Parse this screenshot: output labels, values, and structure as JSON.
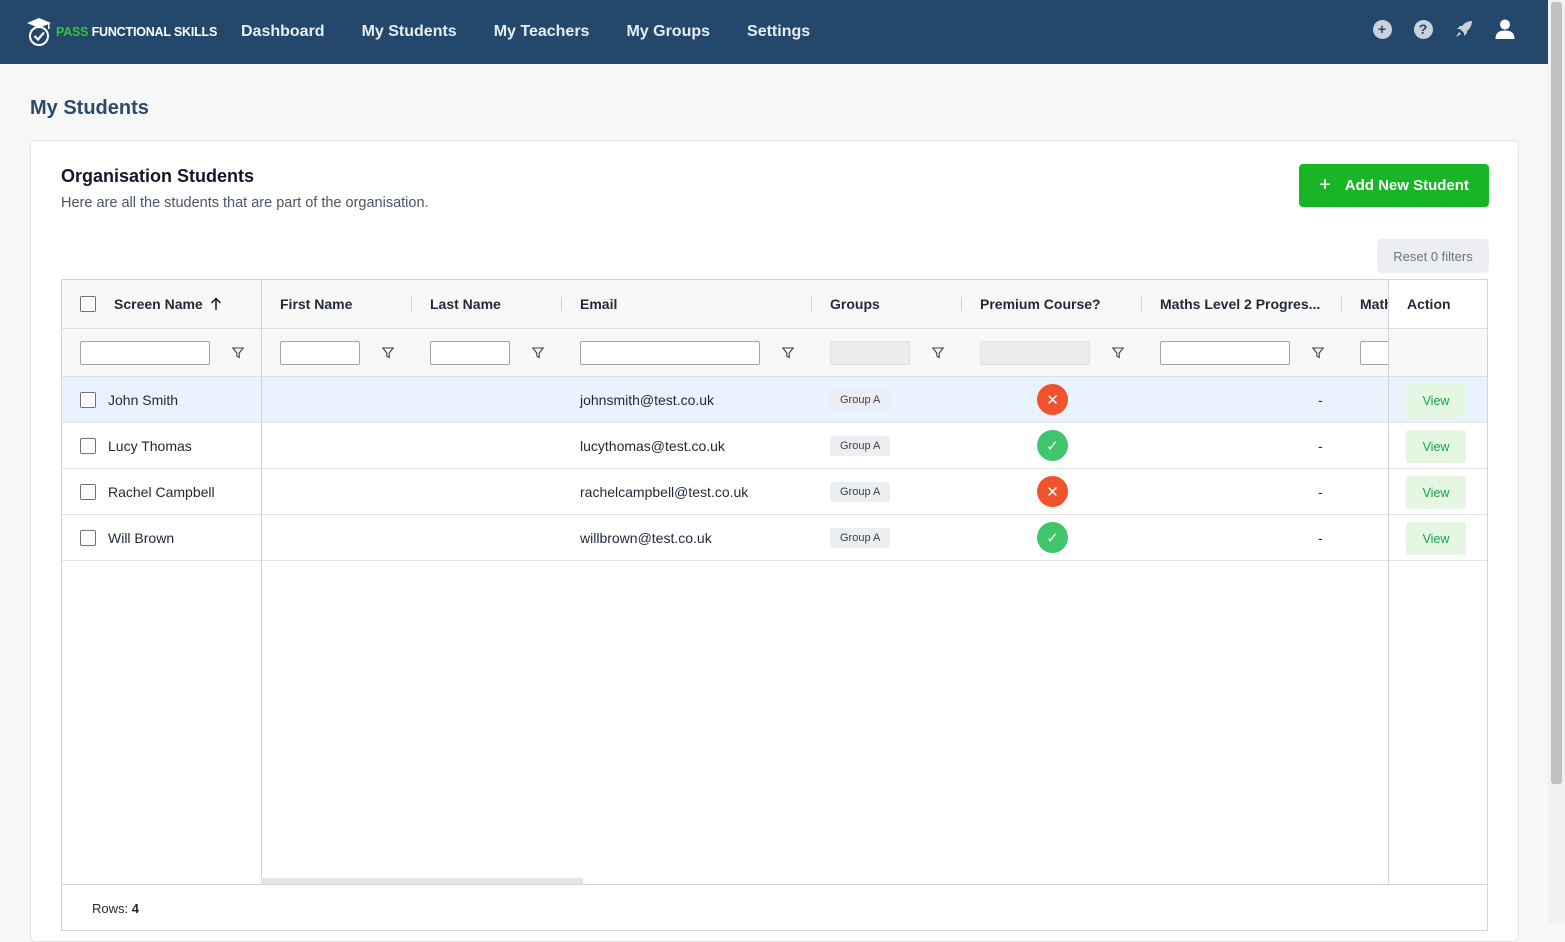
{
  "nav": {
    "brand_pass": "PASS",
    "brand_rest": " FUNCTIONAL SKILLS",
    "links": [
      "Dashboard",
      "My Students",
      "My Teachers",
      "My Groups",
      "Settings"
    ],
    "icons": [
      "plus-circle-icon",
      "help-circle-icon",
      "rocket-icon",
      "user-icon"
    ]
  },
  "page": {
    "title": "My Students"
  },
  "card": {
    "title": "Organisation Students",
    "subtitle": "Here are all the students that are part of the organisation.",
    "add_button": "Add New Student",
    "add_plus": "+",
    "reset_button": "Reset 0 filters"
  },
  "table": {
    "columns": {
      "screen_name": "Screen Name",
      "first_name": "First Name",
      "last_name": "Last Name",
      "email": "Email",
      "groups": "Groups",
      "premium": "Premium Course?",
      "maths_level2": "Maths Level 2 Progres...",
      "maths_trunc": "Math",
      "action": "Action"
    },
    "rows": [
      {
        "screen_name": "John Smith",
        "first_name": "",
        "last_name": "",
        "email": "johnsmith@test.co.uk",
        "group": "Group A",
        "premium": "no",
        "maths": "-",
        "action": "View"
      },
      {
        "screen_name": "Lucy Thomas",
        "first_name": "",
        "last_name": "",
        "email": "lucythomas@test.co.uk",
        "group": "Group A",
        "premium": "yes",
        "maths": "-",
        "action": "View"
      },
      {
        "screen_name": "Rachel Campbell",
        "first_name": "",
        "last_name": "",
        "email": "rachelcampbell@test.co.uk",
        "group": "Group A",
        "premium": "no",
        "maths": "-",
        "action": "View"
      },
      {
        "screen_name": "Will Brown",
        "first_name": "",
        "last_name": "",
        "email": "willbrown@test.co.uk",
        "group": "Group A",
        "premium": "yes",
        "maths": "-",
        "action": "View"
      }
    ],
    "footer": {
      "rows_label": "Rows:",
      "rows_count": "4"
    }
  },
  "colors": {
    "nav_bg": "#24486b",
    "brand_green": "#35c23a",
    "add_button": "#18b526",
    "status_no": "#f1522e",
    "status_yes": "#3fc56c"
  }
}
